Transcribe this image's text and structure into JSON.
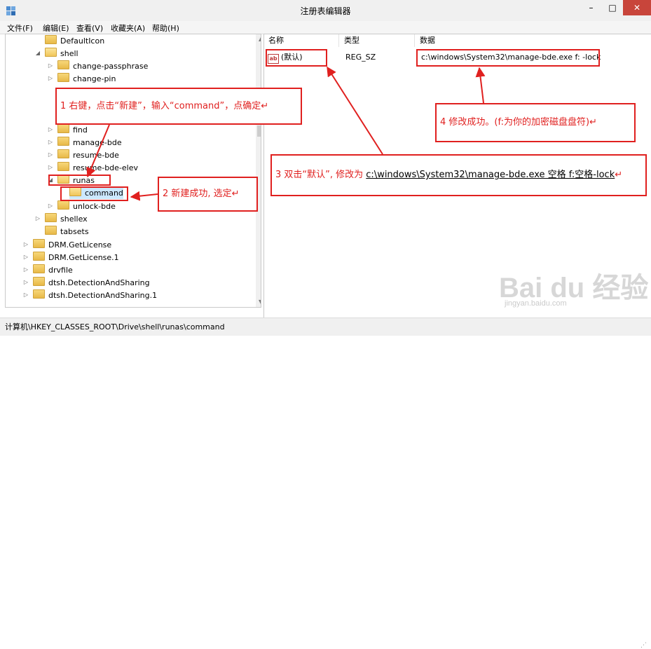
{
  "window": {
    "title": "注册表编辑器",
    "minimize": "–",
    "maximize": "□",
    "close": "✕"
  },
  "menu": [
    "文件(F)",
    "编辑(E)",
    "查看(V)",
    "收藏夹(A)",
    "帮助(H)"
  ],
  "tree": [
    {
      "label": "DefaultIcon"
    },
    {
      "label": "shell"
    },
    {
      "label": "change-passphrase"
    },
    {
      "label": "change-pin"
    },
    {
      "label": "find"
    },
    {
      "label": "manage-bde"
    },
    {
      "label": "resume-bde"
    },
    {
      "label": "resume-bde-elev"
    },
    {
      "label": "runas"
    },
    {
      "label": "command"
    },
    {
      "label": "unlock-bde"
    },
    {
      "label": "shellex"
    },
    {
      "label": "tabsets"
    },
    {
      "label": "DRM.GetLicense"
    },
    {
      "label": "DRM.GetLicense.1"
    },
    {
      "label": "drvfile"
    },
    {
      "label": "dtsh.DetectionAndSharing"
    },
    {
      "label": "dtsh.DetectionAndSharing.1"
    }
  ],
  "list": {
    "headers": {
      "name": "名称",
      "type": "类型",
      "data": "数据"
    },
    "rows": [
      {
        "icon": "ab",
        "name": "(默认)",
        "type": "REG_SZ",
        "data": "c:\\windows\\System32\\manage-bde.exe f: -lock"
      }
    ]
  },
  "status": "计算机\\HKEY_CLASSES_ROOT\\Drive\\shell\\runas\\command",
  "annotations": {
    "a1": "1 右键，点击“新建”，输入“command”，点确定↵",
    "a2": "2 新建成功, 选定↵",
    "a3_prefix": "3 双击“默认”, 修改为 ",
    "a3_value": "c:\\windows\\System32\\manage-bde.exe 空格 f:空格-lock",
    "a3_suffix": "↵",
    "a4": "4 修改成功。(f:为你的加密磁盘盘符)↵"
  },
  "watermark": {
    "main": "Bai du 经验",
    "sub": "jingyan.baidu.com"
  },
  "colors": {
    "annotation": "#e0201f",
    "close_button": "#c8453b",
    "folder": "#f1c65a"
  },
  "icons": {
    "app": "registry-editor-icon",
    "folder": "folder-icon",
    "value": "string-value-icon"
  }
}
